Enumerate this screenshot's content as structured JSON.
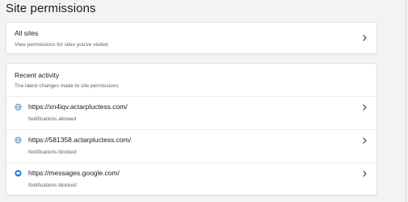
{
  "page": {
    "title": "Site permissions"
  },
  "all_sites": {
    "title": "All sites",
    "subtitle": "View permissions for sites you've visited"
  },
  "recent_activity": {
    "title": "Recent activity",
    "subtitle": "The latest changes made to site permissions",
    "items": [
      {
        "url": "https://xn4iqv.actarpluctess.com/",
        "status": "Notifications allowed",
        "icon": "globe-icon"
      },
      {
        "url": "https://581358.actarpluctess.com/",
        "status": "Notifications blocked",
        "icon": "globe-icon"
      },
      {
        "url": "https://messages.google.com/",
        "status": "Notifications blocked",
        "icon": "google-messages-icon"
      }
    ]
  },
  "colors": {
    "accent": "#0f6cbd",
    "background": "#f3f3f3",
    "card": "#ffffff",
    "secondary_text": "#616161"
  }
}
